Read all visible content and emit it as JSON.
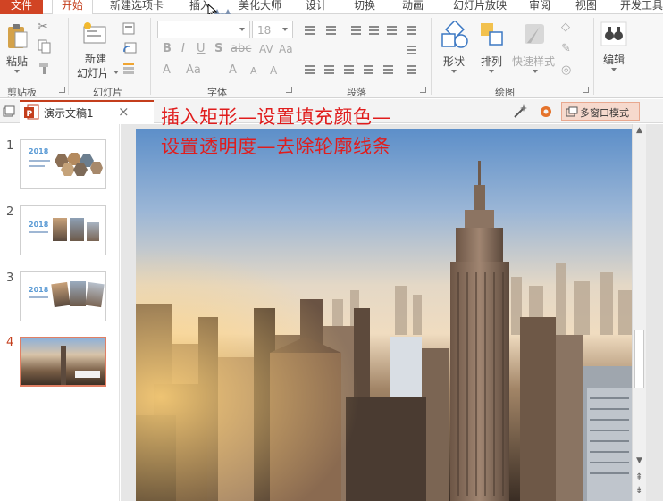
{
  "menu": {
    "tabs": [
      {
        "label": "文件"
      },
      {
        "label": "开始"
      },
      {
        "label": "新建选项卡"
      },
      {
        "label": "插入"
      },
      {
        "label": "美化大师"
      },
      {
        "label": "设计"
      },
      {
        "label": "切换"
      },
      {
        "label": "动画"
      },
      {
        "label": "幻灯片放映"
      },
      {
        "label": "审阅"
      },
      {
        "label": "视图"
      },
      {
        "label": "开发工具"
      }
    ]
  },
  "ribbon": {
    "clipboard": {
      "paste_label": "粘贴",
      "group_label": "剪贴板"
    },
    "slides": {
      "new_slide_label_1": "新建",
      "new_slide_label_2": "幻灯片",
      "group_label": "幻灯片"
    },
    "font": {
      "size_value": "18",
      "group_label": "字体"
    },
    "paragraph": {
      "group_label": "段落"
    },
    "drawing": {
      "shape_label": "形状",
      "arrange_label": "排列",
      "quick_style_label": "快速样式",
      "group_label": "绘图"
    },
    "editing": {
      "edit_label": "编辑"
    }
  },
  "tabstrip": {
    "doc_title": "演示文稿1",
    "close_symbol": "×",
    "multi_window_label": "多窗口模式"
  },
  "slides": [
    {
      "number": "1",
      "year": "2018"
    },
    {
      "number": "2",
      "year": "2018"
    },
    {
      "number": "3",
      "year": "2018"
    },
    {
      "number": "4",
      "year": ""
    }
  ],
  "overlay": {
    "line1": "插入矩形—设置填充颜色—",
    "line2": "设置透明度—去除轮廓线条"
  },
  "colors": {
    "accent": "#c43e1c",
    "overlay_text": "#e01d1d",
    "selection_border": "#e07f64"
  }
}
